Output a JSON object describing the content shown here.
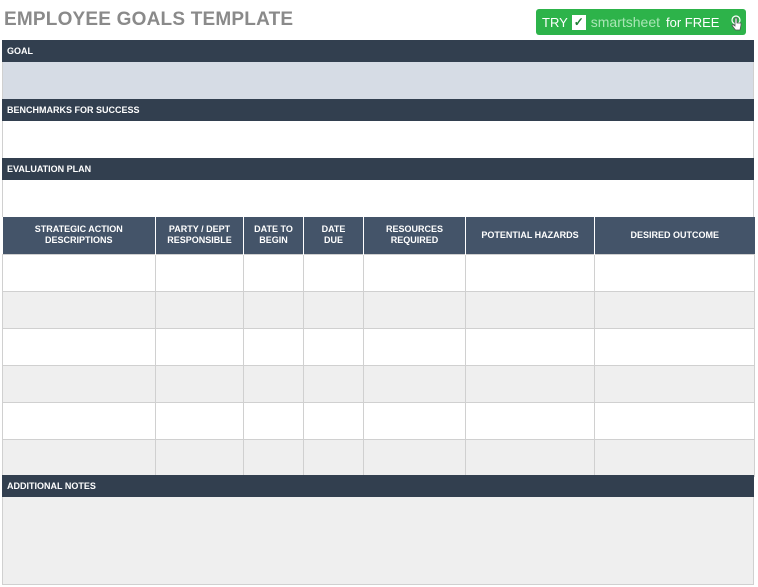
{
  "title": "EMPLOYEE GOALS TEMPLATE",
  "promo": {
    "try": "TRY",
    "brand": "smartsheet",
    "suffix": "for FREE",
    "check_icon": "check-icon",
    "cursor_icon": "hand-pointer-icon",
    "color": "#2db34a"
  },
  "sections": {
    "goal": "GOAL",
    "benchmarks": "BENCHMARKS FOR SUCCESS",
    "evaluation": "EVALUATION PLAN",
    "notes": "ADDITIONAL NOTES"
  },
  "table": {
    "columns": [
      [
        "STRATEGIC ACTION",
        "DESCRIPTIONS"
      ],
      [
        "PARTY / DEPT",
        "RESPONSIBLE"
      ],
      [
        "DATE TO",
        "BEGIN"
      ],
      [
        "DATE",
        "DUE"
      ],
      [
        "RESOURCES",
        "REQUIRED"
      ],
      [
        "POTENTIAL HAZARDS",
        ""
      ],
      [
        "DESIRED OUTCOME",
        ""
      ]
    ],
    "row_count": 6
  },
  "colors": {
    "header_dark": "#323f4f",
    "table_header": "#445469",
    "goal_fill": "#d6dce5",
    "alt_row": "#efefef"
  }
}
